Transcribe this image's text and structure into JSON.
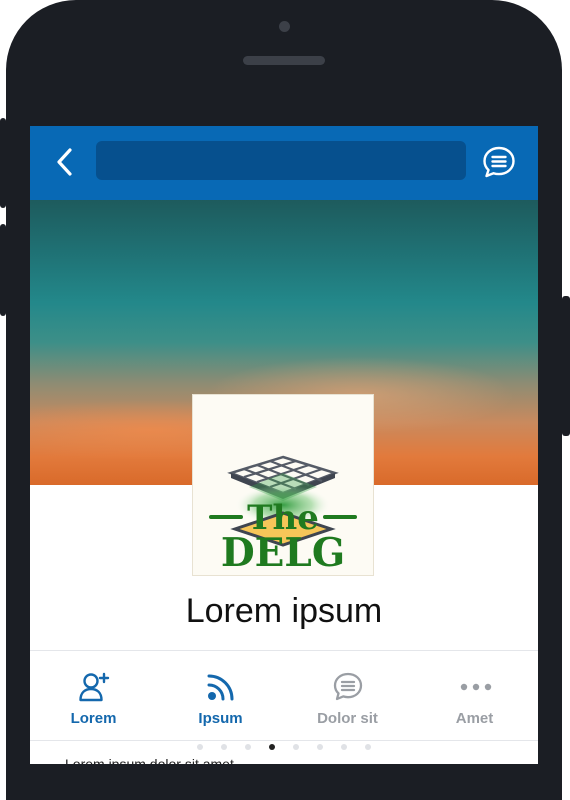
{
  "header": {
    "back_icon": "chevron-left-icon",
    "search": {
      "value": "",
      "placeholder": ""
    },
    "chat_icon": "chat-bubble-icon"
  },
  "profile": {
    "logo": {
      "line1": "The",
      "line2": "DELG"
    },
    "name": "Lorem ipsum"
  },
  "tabs": [
    {
      "label": "Lorem",
      "icon": "add-user-icon",
      "active": true
    },
    {
      "label": "Ipsum",
      "icon": "rss-feed-icon",
      "active": true
    },
    {
      "label": "Dolor sit",
      "icon": "chat-bubble-icon",
      "active": false
    },
    {
      "label": "Amet",
      "icon": "more-dots-icon",
      "active": false
    }
  ],
  "carousel": {
    "total": 8,
    "active_index": 3
  },
  "footer": {
    "text": "Lorem ipsum dolor sit amet"
  },
  "colors": {
    "accent": "#0869b5",
    "search_bg": "#06508e",
    "tab_active": "#1468ad",
    "tab_inactive": "#9a9ea4",
    "logo_green": "#1f7a1f",
    "logo_yellow": "#f6c659",
    "phone_body": "#1b1e24"
  }
}
